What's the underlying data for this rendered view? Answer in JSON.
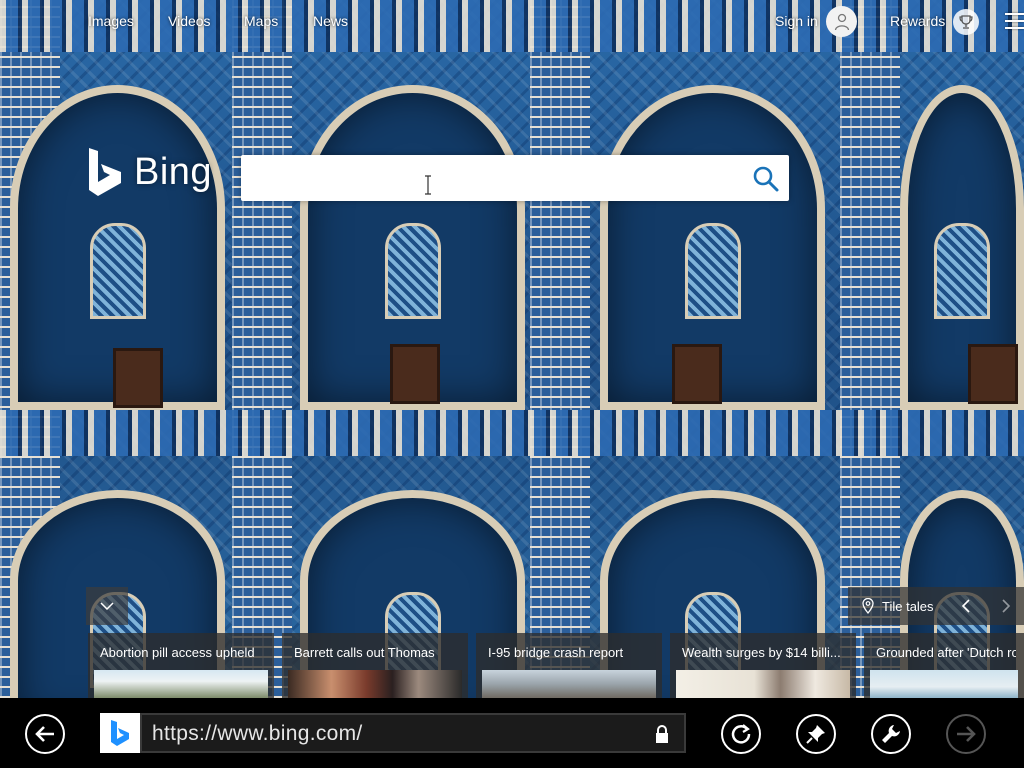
{
  "topnav": {
    "links": [
      "Images",
      "Videos",
      "Maps",
      "News"
    ],
    "signin": "Sign in",
    "rewards": "Rewards"
  },
  "logo": {
    "text": "Bing"
  },
  "search": {
    "value": "",
    "placeholder": ""
  },
  "carousel": {
    "tile_tales": "Tile tales",
    "cards": [
      {
        "title": "Abortion pill access upheld"
      },
      {
        "title": "Barrett calls out Thomas"
      },
      {
        "title": "I-95 bridge crash report"
      },
      {
        "title": "Wealth surges by $14 billi..."
      },
      {
        "title": "Grounded after 'Dutch rol"
      }
    ]
  },
  "browser": {
    "url": "https://www.bing.com/"
  },
  "colors": {
    "bing_teal": "#00809d",
    "search_icon_blue": "#1a73b8",
    "favicon_blue": "#1e90ff"
  }
}
